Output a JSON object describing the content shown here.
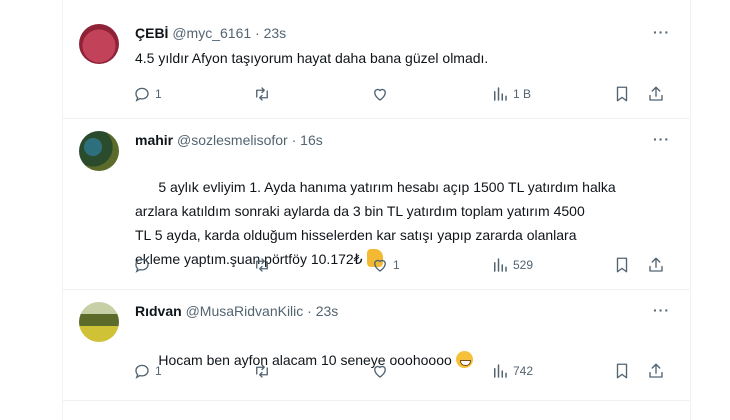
{
  "tweets": [
    {
      "name": "ÇEBİ",
      "handle": "@myc_6161",
      "time": "23s",
      "text": "4.5 yıldır Afyon taşıyorum hayat daha bana güzel olmadı.",
      "replies": "1",
      "likes": "",
      "views": "1 B"
    },
    {
      "name": "mahir",
      "handle": "@sozlesmelisofor",
      "time": "16s",
      "text": "5 aylık evliyim 1. Ayda hanıma yatırım hesabı açıp 1500 TL yatırdım halka\narzlara katıldım sonraki aylarda da 3 bin TL yatırdım toplam yatırım 4500\nTL 5 ayda, karda olduğum hisselerden kar satışı yapıp zararda olanlara\nekleme yaptım.şuan pörtföy 10.172₺",
      "replies": "",
      "likes": "1",
      "views": "529"
    },
    {
      "name": "Rıdvan",
      "handle": "@MusaRidvanKilic",
      "time": "23s",
      "text": "Hocam ben ayfon alacam 10 seneye ooohoooo",
      "replies": "1",
      "likes": "",
      "views": "742"
    }
  ],
  "separator": "·",
  "more_label": "···",
  "icons": [
    "reply-icon",
    "retweet-icon",
    "like-icon",
    "views-icon",
    "bookmark-icon",
    "share-icon",
    "thumbs-up-emoji",
    "grinning-emoji"
  ],
  "colors": {
    "text": "#0f1419",
    "muted": "#536471",
    "border": "#eff3f4"
  }
}
